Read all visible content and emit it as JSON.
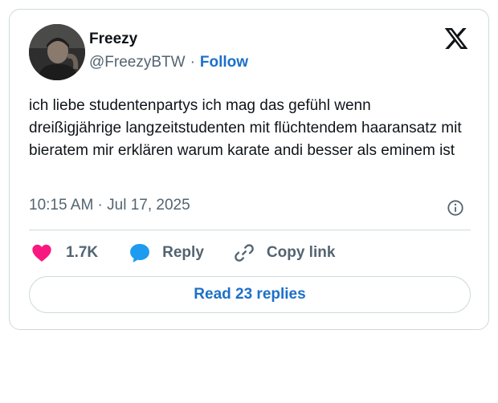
{
  "tweet": {
    "author": {
      "name": "Freezy",
      "handle": "@FreezyBTW",
      "separator": "·",
      "follow_label": "Follow"
    },
    "text": "ich liebe studentenpartys ich mag das gefühl wenn dreißigjährige langzeitstudenten mit flüchtendem haaransatz mit bieratem mir erklären warum karate andi besser als eminem ist",
    "timestamp": "10:15 AM · Jul 17, 2025",
    "actions": {
      "likes": "1.7K",
      "reply_label": "Reply",
      "copy_label": "Copy link"
    },
    "read_replies_label": "Read 23 replies"
  },
  "icons": {
    "logo": "x-logo-icon",
    "info": "info-icon",
    "like": "heart-icon",
    "reply": "reply-bubble-icon",
    "copy": "link-icon"
  },
  "colors": {
    "accent": "#1d70c9",
    "like": "#f91880",
    "reply": "#1d9bf0",
    "muted": "#536471",
    "border": "#cfd9de"
  }
}
